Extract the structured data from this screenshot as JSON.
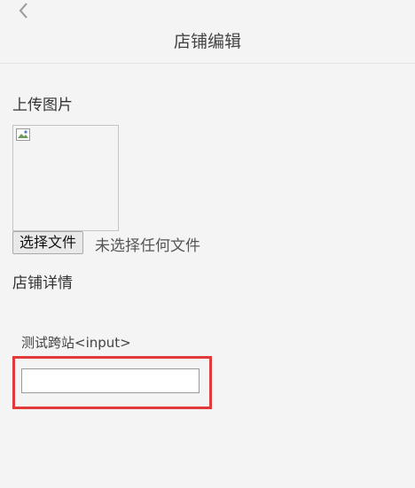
{
  "header": {
    "back_icon": "chevron-left-icon",
    "title": "店铺编辑"
  },
  "upload": {
    "label": "上传图片",
    "image_icon": "broken-image-icon",
    "choose_button": "选择文件",
    "file_status": "未选择任何文件"
  },
  "details": {
    "label": "店铺详情"
  },
  "test_field": {
    "label": "测试跨站<input>",
    "value": "",
    "highlight_color": "#e03a3a"
  }
}
